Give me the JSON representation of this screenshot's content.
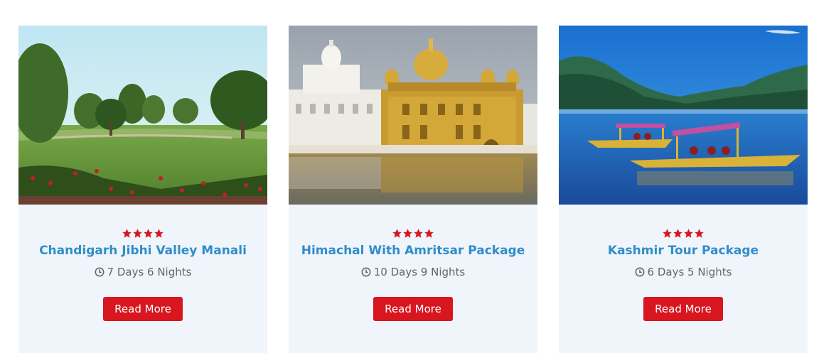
{
  "colors": {
    "title": "#2f8ec9",
    "star": "#d7161f",
    "button": "#d7161f",
    "card_bg": "#f0f4fb",
    "duration_text": "#666666"
  },
  "cards": [
    {
      "image": "chandigarh-garden-photo",
      "rating": 4,
      "title": "Chandigarh Jibhi Valley Manali",
      "duration": "7 Days 6 Nights",
      "button_label": "Read More"
    },
    {
      "image": "golden-temple-photo",
      "rating": 4,
      "title": "Himachal With Amritsar Package",
      "duration": "10 Days 9 Nights",
      "button_label": "Read More"
    },
    {
      "image": "kashmir-shikara-lake-photo",
      "rating": 4,
      "title": "Kashmir Tour Package",
      "duration": "6 Days 5 Nights",
      "button_label": "Read More"
    }
  ]
}
